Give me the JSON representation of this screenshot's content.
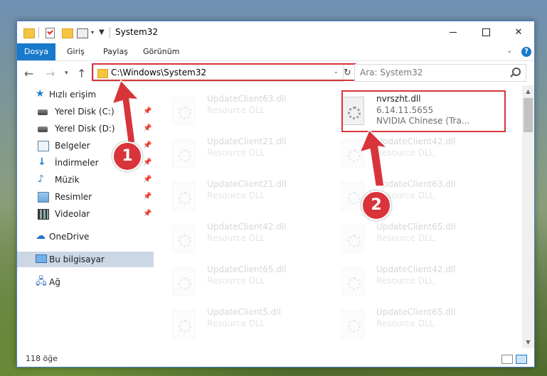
{
  "window": {
    "title": "System32",
    "controls": {
      "minimize": "",
      "maximize": "",
      "close": "✕"
    }
  },
  "ribbon": {
    "tabs": [
      "Dosya",
      "Giriş",
      "Paylaş",
      "Görünüm"
    ],
    "help": "?"
  },
  "navigation": {
    "address": "C:\\Windows\\System32",
    "search_placeholder": "Ara: System32"
  },
  "sidebar": {
    "quick_access": "Hızlı erişim",
    "items": [
      {
        "label": "Yerel Disk (C:)",
        "icon": "drive-icon"
      },
      {
        "label": "Yerel Disk (D:)",
        "icon": "drive-icon"
      },
      {
        "label": "Belgeler",
        "icon": "documents-icon"
      },
      {
        "label": "İndirmeler",
        "icon": "downloads-icon"
      },
      {
        "label": "Müzik",
        "icon": "music-icon"
      },
      {
        "label": "Resimler",
        "icon": "pictures-icon"
      },
      {
        "label": "Videolar",
        "icon": "videos-icon"
      }
    ],
    "onedrive": "OneDrive",
    "this_pc": "Bu bilgisayar",
    "network": "Ağ"
  },
  "files": {
    "left": [
      {
        "name": "UpdateClient63.dll",
        "type": "Resource DLL"
      },
      {
        "name": "UpdateClient21.dll",
        "type": "Resource DLL"
      },
      {
        "name": "UpdateClient21.dll",
        "type": "Resource DLL"
      },
      {
        "name": "UpdateClient42.dll",
        "type": "Resource DLL"
      },
      {
        "name": "UpdateClient65.dll",
        "type": "Resource DLL"
      },
      {
        "name": "UpdateClient5.dll",
        "type": "Resource DLL"
      }
    ],
    "right": [
      {
        "name": "nvrszht.dll",
        "version": "6.14.11.5655",
        "description": "NVIDIA Chinese (Tra..."
      },
      {
        "name": "UpdateClient42.dll",
        "type": "Resource DLL"
      },
      {
        "name": "UpdateClient63.dll",
        "type": "Resource DLL"
      },
      {
        "name": "UpdateClient65.dll",
        "type": "Resource DLL"
      },
      {
        "name": "UpdateClient42.dll",
        "type": "Resource DLL"
      },
      {
        "name": "UpdateClient65.dll",
        "type": "Resource DLL"
      }
    ]
  },
  "status": {
    "count": "118 öğe"
  },
  "annotations": {
    "step1": "1",
    "step2": "2"
  },
  "colors": {
    "accent": "#1979ca",
    "highlight": "#d9343b"
  }
}
